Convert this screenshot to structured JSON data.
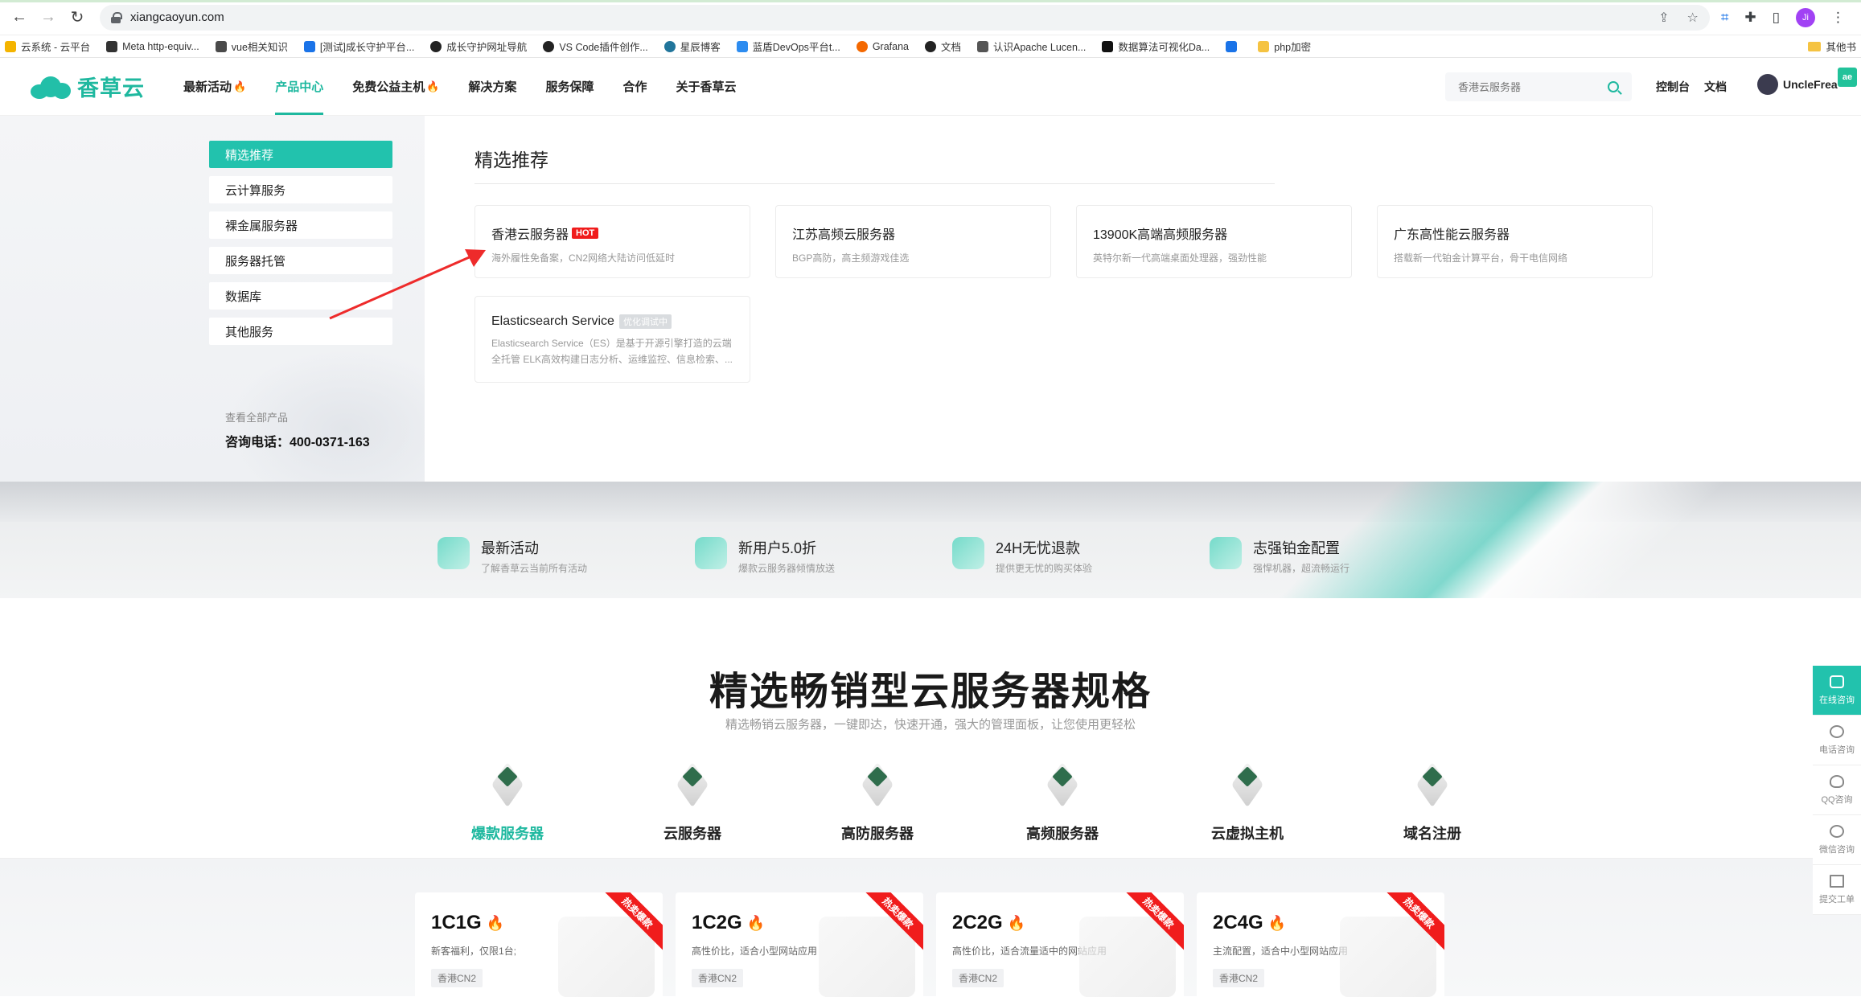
{
  "browser": {
    "url": "xiangcaoyun.com",
    "profile_initial": "Ji",
    "bookmarks": [
      "云系统 - 云平台",
      "Meta http-equiv...",
      "vue相关知识",
      "[测试]成长守护平台...",
      "成长守护网址导航",
      "VS Code插件创作...",
      "星辰博客",
      "蓝盾DevOps平台t...",
      "Grafana",
      "文档",
      "认识Apache Lucen...",
      "数据算法可视化Da...",
      "php加密"
    ],
    "other_bookmarks": "其他书"
  },
  "header": {
    "logo_text": "香草云",
    "nav": [
      "最新活动",
      "产品中心",
      "免费公益主机",
      "解决方案",
      "服务保障",
      "合作",
      "关于香草云"
    ],
    "search_placeholder": "香港云服务器",
    "console": "控制台",
    "docs": "文档",
    "username": "UncleFrea",
    "badge": "ae"
  },
  "mega": {
    "categories": [
      "精选推荐",
      "云计算服务",
      "裸金属服务器",
      "服务器托管",
      "数据库",
      "其他服务"
    ],
    "all_products": "查看全部产品",
    "phone": "咨询电话：400-0371-163",
    "title": "精选推荐",
    "products": [
      {
        "name": "香港云服务器",
        "tag": "HOT",
        "desc": "海外履性免备案，CN2网络大陆访问低延时"
      },
      {
        "name": "江苏高频云服务器",
        "desc": "BGP高防，高主频游戏佳选"
      },
      {
        "name": "13900K高端高频服务器",
        "desc": "英特尔新一代高端桌面处理器，强劲性能"
      },
      {
        "name": "广东高性能云服务器",
        "desc": "搭载新一代铂金计算平台，骨干电信网络"
      },
      {
        "name": "Elasticsearch Service",
        "tag": "optimizing",
        "tag_text": "优化调试中",
        "desc": "Elasticsearch Service（ES）是基于开源引擎打造的云端全托管 ELK高效构建日志分析、运维监控、信息检索、..."
      }
    ]
  },
  "features": [
    {
      "title": "最新活动",
      "sub": "了解香草云当前所有活动"
    },
    {
      "title": "新用户5.0折",
      "sub": "爆款云服务器倾情放送"
    },
    {
      "title": "24H无忧退款",
      "sub": "提供更无忧的购买体验"
    },
    {
      "title": "志强铂金配置",
      "sub": "强悍机器，超流畅运行"
    }
  ],
  "section": {
    "title": "精选畅销型云服务器规格",
    "sub": "精选畅销云服务器，一键即达，快速开通，强大的管理面板，让您使用更轻松",
    "tabs": [
      "爆款服务器",
      "云服务器",
      "高防服务器",
      "高频服务器",
      "云虚拟主机",
      "域名注册"
    ]
  },
  "specs": [
    {
      "name": "1C1G",
      "desc": "新客福利，仅限1台;",
      "loc": "香港CN2",
      "ribbon": "热卖爆款"
    },
    {
      "name": "1C2G",
      "desc": "高性价比，适合小型网站应用",
      "loc": "香港CN2",
      "ribbon": "热卖爆款"
    },
    {
      "name": "2C2G",
      "desc": "高性价比，适合流量适中的网站应用",
      "loc": "香港CN2",
      "ribbon": "热卖爆款"
    },
    {
      "name": "2C4G",
      "desc": "主流配置，适合中小型网站应用",
      "loc": "香港CN2",
      "ribbon": "热卖爆款"
    }
  ],
  "side": [
    "在线咨询",
    "电话咨询",
    "QQ咨询",
    "微信咨询",
    "提交工单"
  ],
  "colors": {
    "accent": "#1eb89f",
    "hot": "#f01c1c",
    "annotation_arrow": "#ee2b2b"
  }
}
